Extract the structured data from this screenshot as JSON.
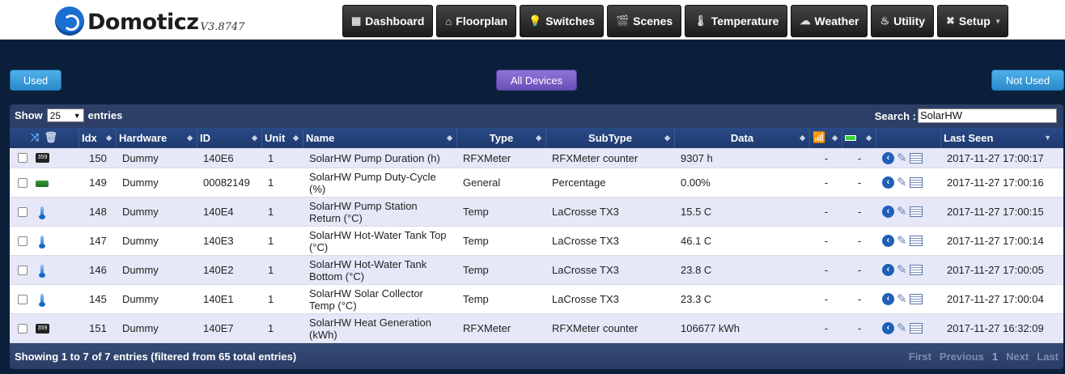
{
  "header": {
    "logo_text": "Domoticz",
    "version": "V3.8747",
    "nav": [
      {
        "label": "Dashboard",
        "icon": "▦"
      },
      {
        "label": "Floorplan",
        "icon": "⌂"
      },
      {
        "label": "Switches",
        "icon": "💡"
      },
      {
        "label": "Scenes",
        "icon": "🎬"
      },
      {
        "label": "Temperature",
        "icon": "🌡"
      },
      {
        "label": "Weather",
        "icon": "☁"
      },
      {
        "label": "Utility",
        "icon": "♨"
      },
      {
        "label": "Setup",
        "icon": "✖",
        "caret": "▾"
      }
    ]
  },
  "filters": {
    "used": "Used",
    "all": "All Devices",
    "not_used": "Not Used"
  },
  "table": {
    "show_label": "Show",
    "page_size": "25",
    "entries_label": "entries",
    "search_label": "Search :",
    "search_value": "SolarHW",
    "columns": {
      "idx": "Idx",
      "hardware": "Hardware",
      "id": "ID",
      "unit": "Unit",
      "name": "Name",
      "type": "Type",
      "subtype": "SubType",
      "data": "Data",
      "last_seen": "Last Seen"
    },
    "rows": [
      {
        "icon": "meter",
        "icon_text": "359",
        "idx": "150",
        "hardware": "Dummy",
        "id": "140E6",
        "unit": "1",
        "name": "SolarHW Pump Duration (h)",
        "type": "RFXMeter",
        "subtype": "RFXMeter counter",
        "data": "9307 h",
        "signal": "-",
        "battery": "-",
        "last_seen": "2017-11-27 17:00:17"
      },
      {
        "icon": "pct",
        "icon_text": "",
        "idx": "149",
        "hardware": "Dummy",
        "id": "00082149",
        "unit": "1",
        "name": "SolarHW Pump Duty-Cycle (%)",
        "type": "General",
        "subtype": "Percentage",
        "data": "0.00%",
        "signal": "-",
        "battery": "-",
        "last_seen": "2017-11-27 17:00:16"
      },
      {
        "icon": "therm",
        "icon_text": "",
        "idx": "148",
        "hardware": "Dummy",
        "id": "140E4",
        "unit": "1",
        "name": "SolarHW Pump Station Return (°C)",
        "type": "Temp",
        "subtype": "LaCrosse TX3",
        "data": "15.5 C",
        "signal": "-",
        "battery": "-",
        "last_seen": "2017-11-27 17:00:15"
      },
      {
        "icon": "therm",
        "icon_text": "",
        "idx": "147",
        "hardware": "Dummy",
        "id": "140E3",
        "unit": "1",
        "name": "SolarHW Hot-Water Tank Top (°C)",
        "type": "Temp",
        "subtype": "LaCrosse TX3",
        "data": "46.1 C",
        "signal": "-",
        "battery": "-",
        "last_seen": "2017-11-27 17:00:14"
      },
      {
        "icon": "therm",
        "icon_text": "",
        "idx": "146",
        "hardware": "Dummy",
        "id": "140E2",
        "unit": "1",
        "name": "SolarHW Hot-Water Tank Bottom (°C)",
        "type": "Temp",
        "subtype": "LaCrosse TX3",
        "data": "23.8 C",
        "signal": "-",
        "battery": "-",
        "last_seen": "2017-11-27 17:00:05"
      },
      {
        "icon": "therm",
        "icon_text": "",
        "idx": "145",
        "hardware": "Dummy",
        "id": "140E1",
        "unit": "1",
        "name": "SolarHW Solar Collector Temp (°C)",
        "type": "Temp",
        "subtype": "LaCrosse TX3",
        "data": "23.3 C",
        "signal": "-",
        "battery": "-",
        "last_seen": "2017-11-27 17:00:04"
      },
      {
        "icon": "meter",
        "icon_text": "359",
        "idx": "151",
        "hardware": "Dummy",
        "id": "140E7",
        "unit": "1",
        "name": "SolarHW Heat Generation (kWh)",
        "type": "RFXMeter",
        "subtype": "RFXMeter counter",
        "data": "106677 kWh",
        "signal": "-",
        "battery": "-",
        "last_seen": "2017-11-27 16:32:09"
      }
    ],
    "footer_info": "Showing 1 to 7 of 7 entries (filtered from 65 total entries)",
    "pager": {
      "first": "First",
      "previous": "Previous",
      "page": "1",
      "next": "Next",
      "last": "Last"
    }
  },
  "colors": {
    "page_bg": "#0b1f3a",
    "header_bg": "#2a4a86",
    "row_odd": "#e6e8f7",
    "accent_blue": "#2b8acb",
    "accent_purple": "#6a4fb8"
  }
}
